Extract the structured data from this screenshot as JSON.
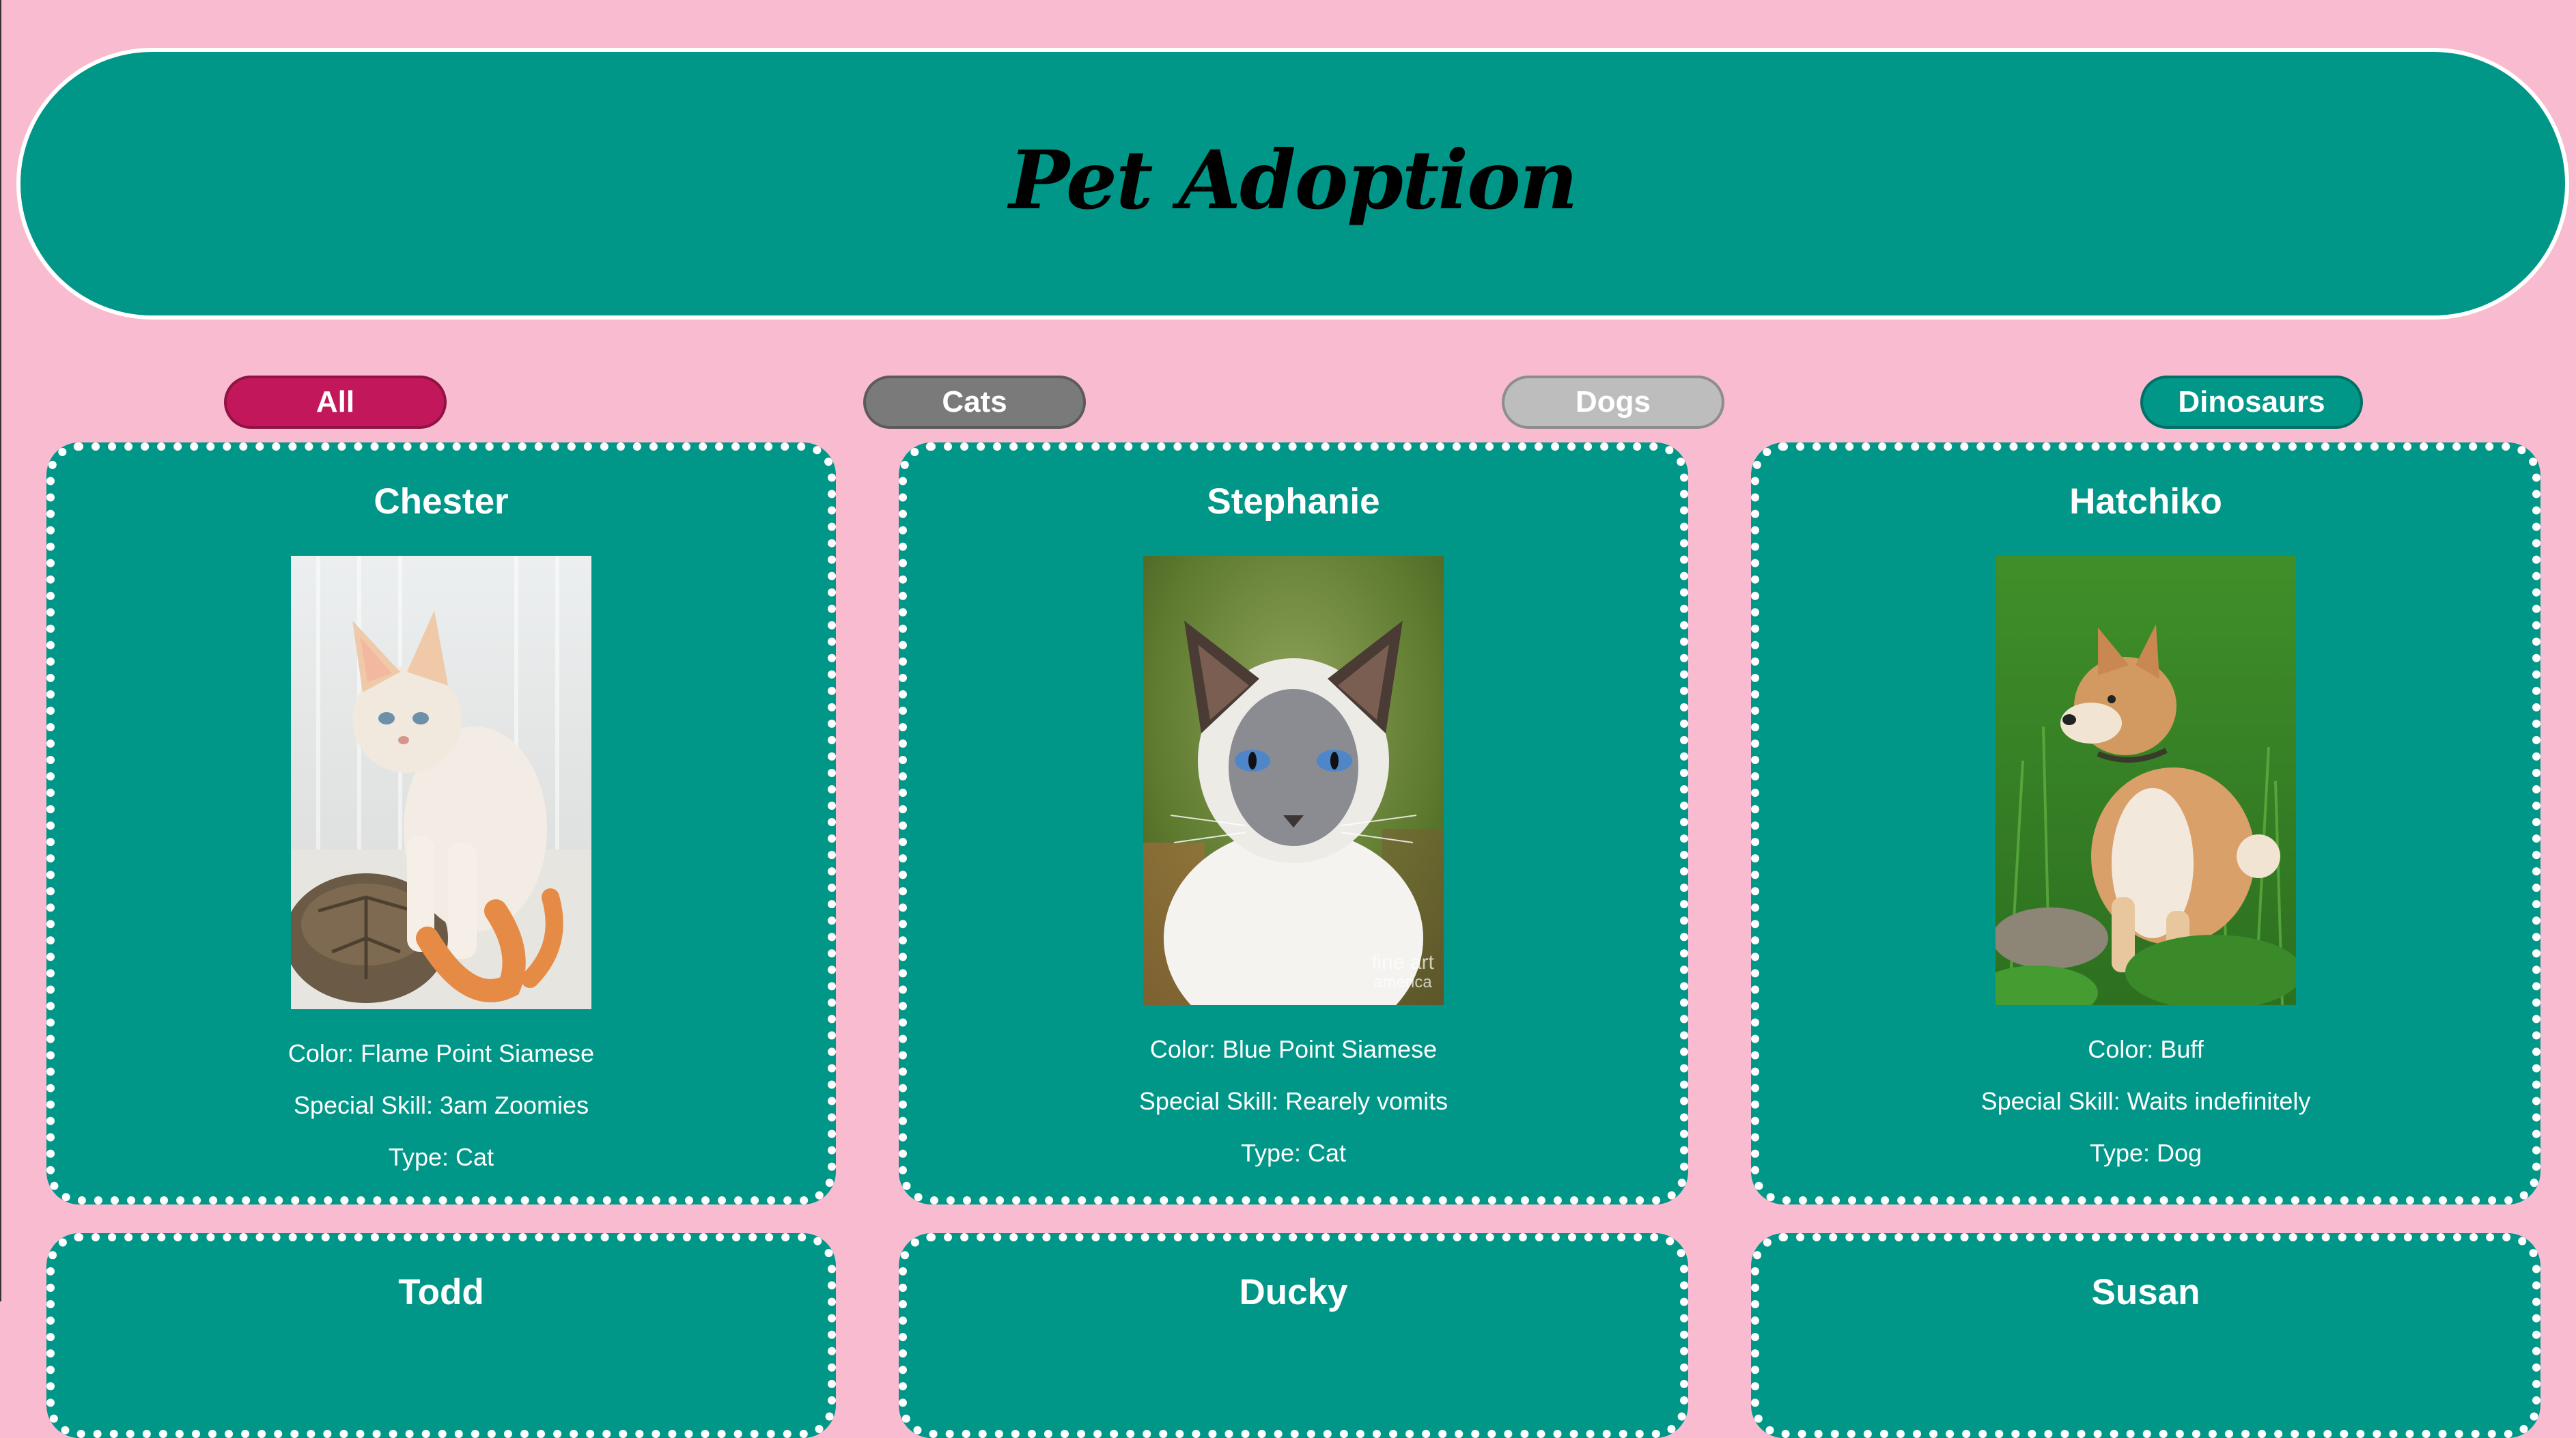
{
  "header": {
    "title": "Pet Adoption"
  },
  "filters": [
    {
      "label": "All",
      "color": "#c2185b"
    },
    {
      "label": "Cats",
      "color": "#7a7a7a"
    },
    {
      "label": "Dogs",
      "color": "#bdbdbd"
    },
    {
      "label": "Dinosaurs",
      "color": "#009688"
    }
  ],
  "pets": [
    {
      "name": "Chester",
      "color_line": "Color: Flame Point Siamese",
      "skill_line": "Special Skill: 3am Zoomies",
      "type_line": "Type: Cat",
      "photo_icon": "cat-photo"
    },
    {
      "name": "Stephanie",
      "color_line": "Color: Blue Point Siamese",
      "skill_line": "Special Skill: Rearely vomits",
      "type_line": "Type: Cat",
      "photo_icon": "cat-photo",
      "watermark": "fineart america"
    },
    {
      "name": "Hatchiko",
      "color_line": "Color: Buff",
      "skill_line": "Special Skill: Waits indefinitely",
      "type_line": "Type: Dog",
      "photo_icon": "dog-photo"
    },
    {
      "name": "Todd"
    },
    {
      "name": "Ducky"
    },
    {
      "name": "Susan"
    }
  ],
  "colors": {
    "page_background": "#f8bbd0",
    "card_background": "#009688",
    "card_border": "#ffffff"
  }
}
